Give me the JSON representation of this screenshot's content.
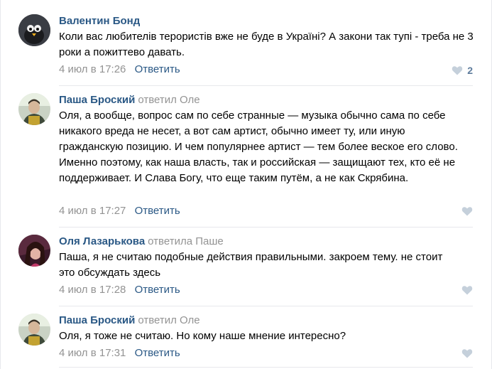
{
  "comments": [
    {
      "author": "Валентин Бонд",
      "replied_text": "",
      "reply_to": "",
      "text": "Коли вас любителів терористів вже не буде в Україні? А закони так тупі - треба не 3 роки а пожиттево давать.",
      "date": "4 июл в 17:26",
      "reply_label": "Ответить",
      "likes": "2"
    },
    {
      "author": "Паша Броский",
      "replied_text": "ответил",
      "reply_to": "Оле",
      "text": "Оля, а вообще, вопрос сам по себе странные — музыка обычно сама по себе никакого вреда не несет, а вот сам артист, обычно имеет ту, или иную гражданскую позицию. И чем популярнее артист — тем более веское его слово. Именно поэтому, как наша власть, так и российская — защищают тех, кто её не поддерживает. И Слава Богу, что еще таким путём, а не как Скрябина.",
      "date": "4 июл в 17:27",
      "reply_label": "Ответить",
      "likes": ""
    },
    {
      "author": "Оля Лазарькова",
      "replied_text": "ответила",
      "reply_to": "Паше",
      "text": "Паша, я не считаю подобные действия правильными. закроем тему. не стоит это обсуждать здесь",
      "date": "4 июл в 17:28",
      "reply_label": "Ответить",
      "likes": ""
    },
    {
      "author": "Паша Броский",
      "replied_text": "ответил",
      "reply_to": "Оле",
      "text": "Оля, я тоже не считаю. Но кому наше мнение интересно?",
      "date": "4 июл в 17:31",
      "reply_label": "Ответить",
      "likes": ""
    }
  ],
  "colors": {
    "link": "#2a5885",
    "muted": "#939393",
    "like_icon": "#c5d0db",
    "separator": "#e7e8ec"
  },
  "icons": {
    "like": "heart-icon"
  }
}
